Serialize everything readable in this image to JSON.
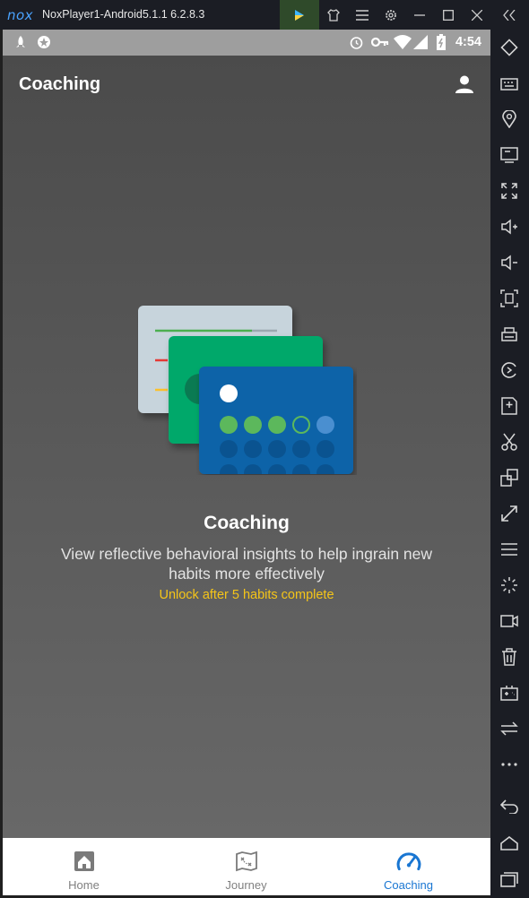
{
  "window": {
    "logo": "nox",
    "title": "NoxPlayer1-Android5.1.1 6.2.8.3"
  },
  "status_bar": {
    "time": "4:54"
  },
  "app_bar": {
    "title": "Coaching"
  },
  "empty_state": {
    "title": "Coaching",
    "description": "View reflective behavioral insights to help ingrain new habits more effectively",
    "unlock_note": "Unlock after 5 habits complete"
  },
  "bottom_nav": {
    "items": [
      {
        "label": "Home",
        "icon": "home-icon"
      },
      {
        "label": "Journey",
        "icon": "map-icon"
      },
      {
        "label": "Coaching",
        "icon": "speedometer-icon"
      }
    ],
    "active_index": 2
  },
  "colors": {
    "accent": "#1976d2",
    "unlock": "#f5c518",
    "card_green": "#00a86b",
    "card_blue": "#0d64a8",
    "card_grey": "#c7d4dc"
  },
  "sidebar_tools": [
    "rotate-icon",
    "keyboard-icon",
    "location-icon",
    "screen-icon",
    "fullscreen-icon",
    "volume-up-icon",
    "volume-down-icon",
    "screenshot-icon",
    "print-icon",
    "record-icon",
    "apk-icon",
    "scissors-icon",
    "multi-instance-icon",
    "resize-icon",
    "menu-icon",
    "loading-icon",
    "video-icon",
    "trash-icon",
    "gamepad-icon",
    "sync-icon",
    "more-icon",
    "back-icon",
    "home-nav-icon",
    "recents-icon"
  ]
}
